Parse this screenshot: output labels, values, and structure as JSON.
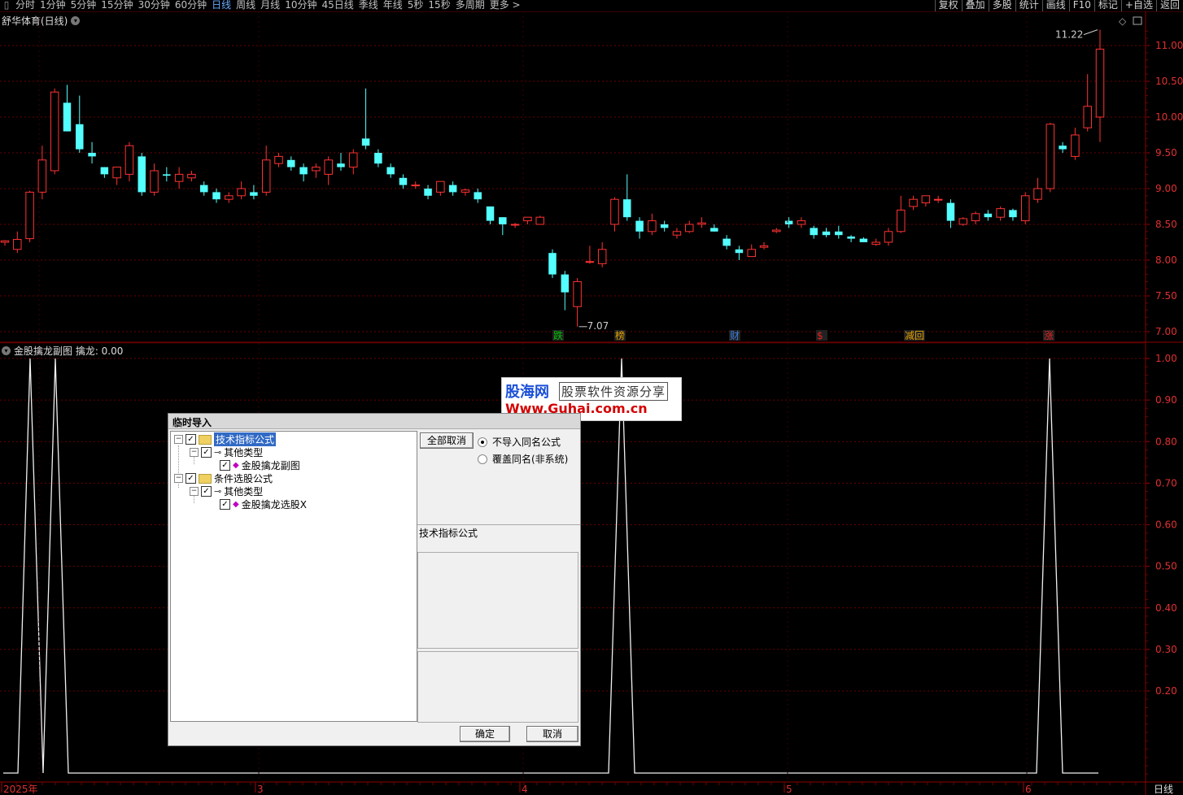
{
  "periods": [
    "分时",
    "1分钟",
    "5分钟",
    "15分钟",
    "30分钟",
    "60分钟",
    "日线",
    "周线",
    "月线",
    "10分钟",
    "45日线",
    "季线",
    "年线",
    "5秒",
    "15秒",
    "多周期",
    "更多 >"
  ],
  "active_period": "日线",
  "tools": [
    "复权",
    "叠加",
    "多股",
    "统计",
    "画线",
    "F10",
    "标记",
    "+自选",
    "返回"
  ],
  "stock_title": "舒华体育(日线)",
  "sub_title": "金股擒龙副图  擒龙: 0.00",
  "main_axis_labels": [
    "11.00",
    "10.50",
    "10.00",
    "9.50",
    "9.00",
    "8.50",
    "8.00",
    "7.50",
    "7.00"
  ],
  "sub_axis_labels": [
    "1.00",
    "0.90",
    "0.80",
    "0.70",
    "0.60",
    "0.50",
    "0.40",
    "0.30",
    "0.20"
  ],
  "time_labels": [
    "2025年",
    "3",
    "4",
    "5",
    "6"
  ],
  "period_indicator": "日线",
  "high_label": "11.22",
  "low_label": "7.07",
  "markers": [
    {
      "text": "跌",
      "color": "#00c000"
    },
    {
      "text": "榜",
      "color": "#e0a000"
    },
    {
      "text": "财",
      "color": "#3a7ee0"
    },
    {
      "text": "$",
      "color": "#e02020"
    },
    {
      "text": "减回",
      "color": "#e0a000"
    },
    {
      "text": "涨",
      "color": "#e02020"
    }
  ],
  "watermark": {
    "line1": "股海网",
    "line2": "股票软件资源分享",
    "line3": "Www.Guhai.com.cn"
  },
  "dialog": {
    "title": "临时导入",
    "tree": [
      {
        "label": "技术指标公式",
        "level": 0
      },
      {
        "label": "其他类型",
        "level": 1
      },
      {
        "label": "金股擒龙副图",
        "level": 2
      },
      {
        "label": "条件选股公式",
        "level": 0
      },
      {
        "label": "其他类型",
        "level": 1
      },
      {
        "label": "金股擒龙选股X",
        "level": 2
      }
    ],
    "btn_cancel_all": "全部取消",
    "radio1": "不导入同名公式",
    "radio2": "覆盖同名(非系统)",
    "section_label": "技术指标公式",
    "ok": "确定",
    "cancel": "取消"
  },
  "chart_data": {
    "type": "candlestick",
    "ylim": [
      6.95,
      11.3
    ],
    "candles": [
      [
        8.25,
        8.27,
        8.2,
        8.28
      ],
      [
        8.15,
        8.29,
        8.1,
        8.4
      ],
      [
        8.3,
        8.95,
        8.25,
        8.97
      ],
      [
        8.95,
        9.4,
        8.85,
        9.6
      ],
      [
        9.25,
        10.35,
        9.2,
        10.4
      ],
      [
        10.2,
        9.8,
        9.8,
        10.45
      ],
      [
        9.9,
        9.55,
        9.5,
        10.3
      ],
      [
        9.5,
        9.45,
        9.35,
        9.65
      ],
      [
        9.3,
        9.2,
        9.15,
        9.3
      ],
      [
        9.15,
        9.3,
        9.05,
        9.3
      ],
      [
        9.2,
        9.6,
        9.1,
        9.65
      ],
      [
        9.45,
        8.95,
        8.9,
        9.5
      ],
      [
        8.95,
        9.25,
        8.9,
        9.35
      ],
      [
        9.2,
        9.18,
        9.1,
        9.3
      ],
      [
        9.1,
        9.2,
        9.0,
        9.3
      ],
      [
        9.15,
        9.2,
        9.1,
        9.25
      ],
      [
        9.05,
        8.95,
        8.9,
        9.1
      ],
      [
        8.95,
        8.85,
        8.8,
        9.0
      ],
      [
        8.85,
        8.9,
        8.8,
        8.95
      ],
      [
        8.9,
        9.0,
        8.85,
        9.1
      ],
      [
        8.95,
        8.9,
        8.85,
        9.05
      ],
      [
        8.95,
        9.4,
        8.9,
        9.6
      ],
      [
        9.35,
        9.45,
        9.3,
        9.5
      ],
      [
        9.4,
        9.3,
        9.25,
        9.45
      ],
      [
        9.3,
        9.2,
        9.1,
        9.35
      ],
      [
        9.25,
        9.3,
        9.15,
        9.35
      ],
      [
        9.2,
        9.4,
        9.05,
        9.45
      ],
      [
        9.35,
        9.3,
        9.25,
        9.5
      ],
      [
        9.3,
        9.5,
        9.2,
        9.55
      ],
      [
        9.7,
        9.6,
        9.55,
        10.4
      ],
      [
        9.5,
        9.35,
        9.3,
        9.55
      ],
      [
        9.3,
        9.2,
        9.15,
        9.35
      ],
      [
        9.15,
        9.05,
        9.0,
        9.2
      ],
      [
        9.05,
        9.05,
        9.0,
        9.1
      ],
      [
        9.0,
        8.9,
        8.85,
        9.05
      ],
      [
        8.95,
        9.1,
        8.9,
        9.1
      ],
      [
        9.05,
        8.95,
        8.9,
        9.1
      ],
      [
        8.95,
        8.98,
        8.9,
        9.0
      ],
      [
        8.95,
        8.85,
        8.8,
        9.0
      ],
      [
        8.75,
        8.55,
        8.5,
        8.75
      ],
      [
        8.6,
        8.5,
        8.35,
        8.6
      ],
      [
        8.5,
        8.5,
        8.45,
        8.52
      ],
      [
        8.55,
        8.6,
        8.5,
        8.6
      ],
      [
        8.5,
        8.6,
        8.5,
        8.62
      ],
      [
        8.1,
        7.8,
        7.75,
        8.15
      ],
      [
        7.8,
        7.55,
        7.3,
        7.85
      ],
      [
        7.35,
        7.7,
        7.07,
        7.75
      ],
      [
        7.98,
        7.98,
        7.95,
        8.2
      ],
      [
        7.95,
        8.15,
        7.9,
        8.25
      ],
      [
        8.5,
        8.85,
        8.4,
        8.88
      ],
      [
        8.85,
        8.6,
        8.55,
        9.2
      ],
      [
        8.55,
        8.4,
        8.3,
        8.6
      ],
      [
        8.4,
        8.55,
        8.35,
        8.65
      ],
      [
        8.5,
        8.45,
        8.4,
        8.55
      ],
      [
        8.35,
        8.4,
        8.3,
        8.45
      ],
      [
        8.4,
        8.5,
        8.38,
        8.55
      ],
      [
        8.5,
        8.52,
        8.45,
        8.6
      ],
      [
        8.45,
        8.4,
        8.4,
        8.5
      ],
      [
        8.3,
        8.2,
        8.15,
        8.35
      ],
      [
        8.15,
        8.1,
        8.0,
        8.2
      ],
      [
        8.05,
        8.15,
        8.05,
        8.22
      ],
      [
        8.18,
        8.2,
        8.15,
        8.25
      ],
      [
        8.4,
        8.42,
        8.38,
        8.45
      ],
      [
        8.55,
        8.5,
        8.45,
        8.6
      ],
      [
        8.5,
        8.55,
        8.45,
        8.6
      ],
      [
        8.45,
        8.35,
        8.3,
        8.48
      ],
      [
        8.4,
        8.35,
        8.32,
        8.45
      ],
      [
        8.4,
        8.35,
        8.3,
        8.48
      ],
      [
        8.33,
        8.3,
        8.25,
        8.35
      ],
      [
        8.3,
        8.25,
        8.25,
        8.32
      ],
      [
        8.22,
        8.25,
        8.2,
        8.3
      ],
      [
        8.25,
        8.4,
        8.2,
        8.45
      ],
      [
        8.4,
        8.7,
        8.38,
        8.9
      ],
      [
        8.75,
        8.85,
        8.7,
        8.9
      ],
      [
        8.8,
        8.9,
        8.75,
        8.9
      ],
      [
        8.85,
        8.85,
        8.8,
        8.9
      ],
      [
        8.8,
        8.55,
        8.45,
        8.85
      ],
      [
        8.5,
        8.58,
        8.48,
        8.6
      ],
      [
        8.55,
        8.65,
        8.5,
        8.68
      ],
      [
        8.65,
        8.6,
        8.55,
        8.7
      ],
      [
        8.6,
        8.72,
        8.55,
        8.75
      ],
      [
        8.7,
        8.6,
        8.55,
        8.72
      ],
      [
        8.55,
        8.9,
        8.5,
        8.95
      ],
      [
        8.85,
        9.0,
        8.8,
        9.15
      ],
      [
        9.0,
        9.9,
        8.95,
        9.92
      ],
      [
        9.6,
        9.55,
        9.5,
        9.65
      ],
      [
        9.45,
        9.75,
        9.4,
        9.85
      ],
      [
        9.85,
        10.15,
        9.8,
        10.6
      ],
      [
        10.0,
        10.95,
        9.65,
        11.22
      ]
    ],
    "indicator_peaks": [
      [
        0.07,
        1.0
      ],
      [
        0.2,
        1.0
      ],
      [
        0.51,
        1.0
      ],
      [
        0.91,
        1.0
      ]
    ]
  }
}
